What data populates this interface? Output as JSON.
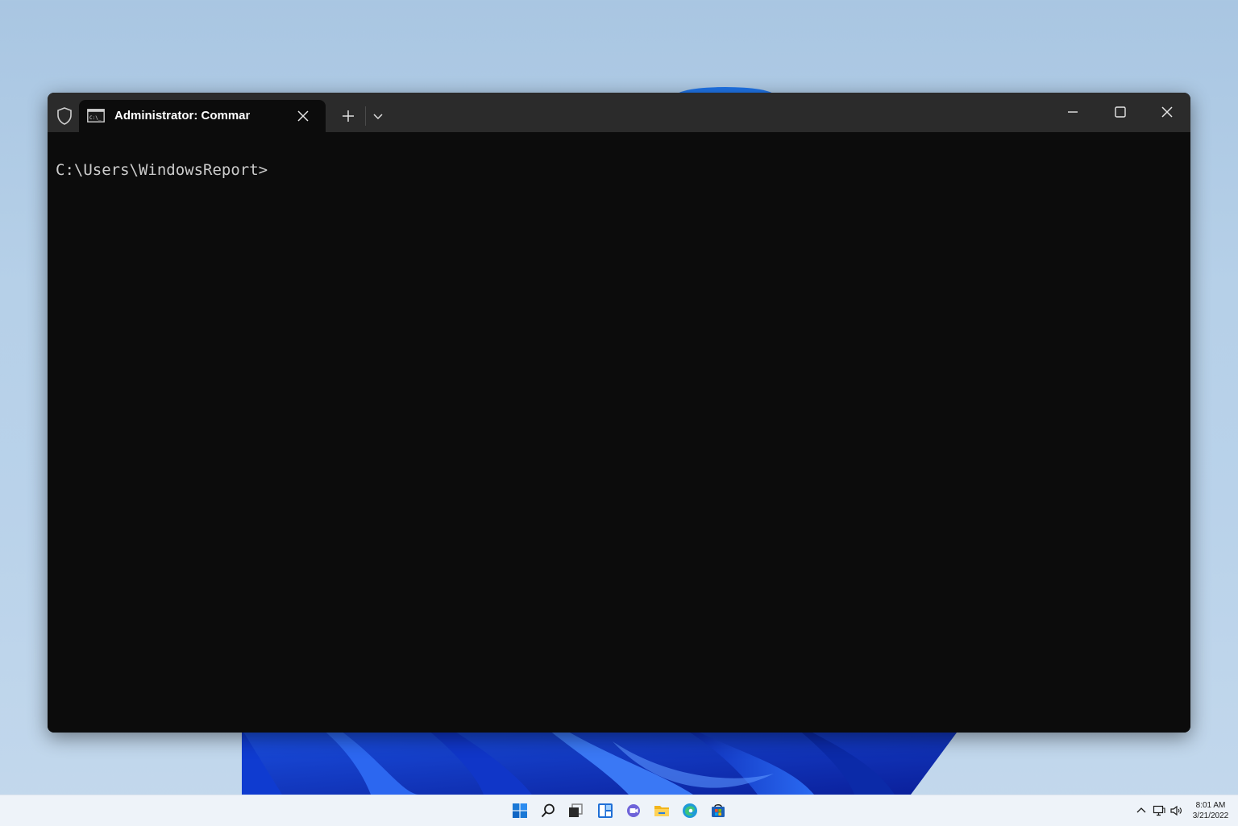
{
  "window": {
    "tab_title": "Administrator: Command Pro",
    "tab_icon": "cmd-icon",
    "security_icon": "shield-icon"
  },
  "console": {
    "prompt": "C:\\Users\\WindowsReport>"
  },
  "taskbar": {
    "apps": [
      "start-icon",
      "search-icon",
      "task-view-icon",
      "widgets-icon",
      "chat-icon",
      "file-explorer-icon",
      "edge-icon",
      "store-icon"
    ],
    "tray": [
      "chevron-up-icon",
      "network-icon",
      "volume-icon"
    ],
    "time": "8:01 AM",
    "date": "3/21/2022"
  },
  "colors": {
    "console_bg": "#0c0c0c",
    "titlebar_bg": "#2b2b2b",
    "accent": "#0067c0"
  }
}
